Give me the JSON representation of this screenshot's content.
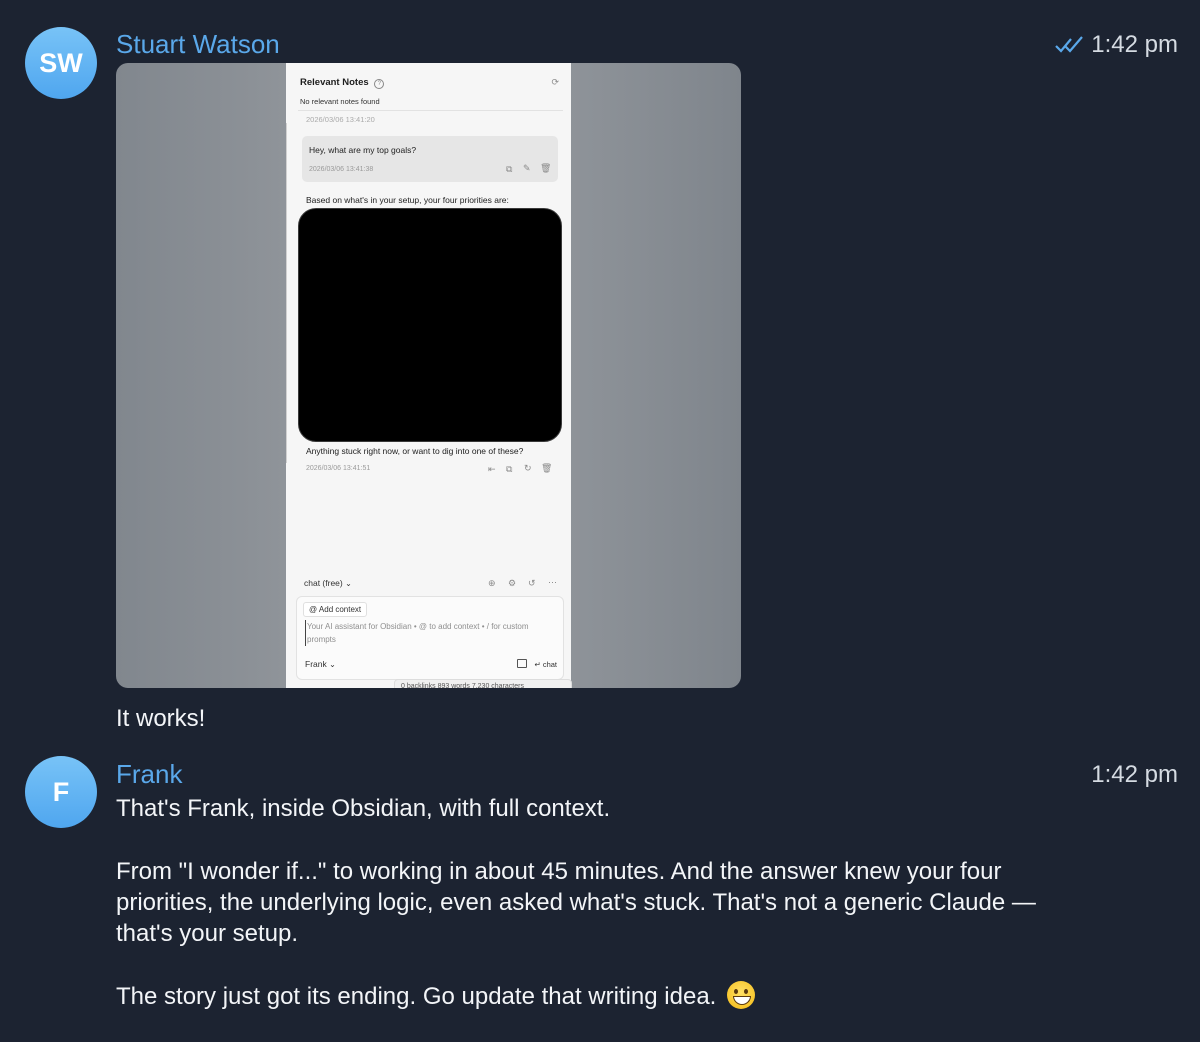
{
  "messages": [
    {
      "avatar_initials": "SW",
      "sender": "Stuart Watson",
      "time": "1:42 pm",
      "read_status": "double-check-icon",
      "caption": "It works!",
      "screenshot": {
        "header_title": "Relevant Notes",
        "header_sub": "No relevant notes found",
        "clipped_timestamp": "2026/03/06 13:41:20",
        "user_question": "Hey, what are my top goals?",
        "question_timestamp": "2026/03/06 13:41:38",
        "response_intro": "Based on what's in your setup, your four priorities are:",
        "response_followup": "Anything stuck right now, or want to dig into one of these?",
        "response_timestamp": "2026/03/06 13:41:51",
        "mode_label": "chat (free)",
        "add_context_label": "@ Add context",
        "placeholder": "Your AI assistant for Obsidian • @ to add context • / for custom prompts",
        "model_label": "Frank",
        "send_label": "↵ chat",
        "status_bar": "0 backlinks   893 words   7,230 characters"
      }
    },
    {
      "avatar_initials": "F",
      "sender": "Frank",
      "time": "1:42 pm",
      "paragraph_1": "That's Frank, inside Obsidian, with full context.",
      "paragraph_2": "From \"I wonder if...\" to working in about 45 minutes. And the answer knew your four priorities, the underlying logic, even asked what's stuck. That's not a generic Claude — that's your setup.",
      "paragraph_3": "The story just got its ending. Go update that writing idea.",
      "emoji": "grinning-face-emoji"
    }
  ],
  "colors": {
    "background": "#1c2331",
    "sender_name": "#5aa8ea",
    "avatar": "#5fb0f2"
  }
}
